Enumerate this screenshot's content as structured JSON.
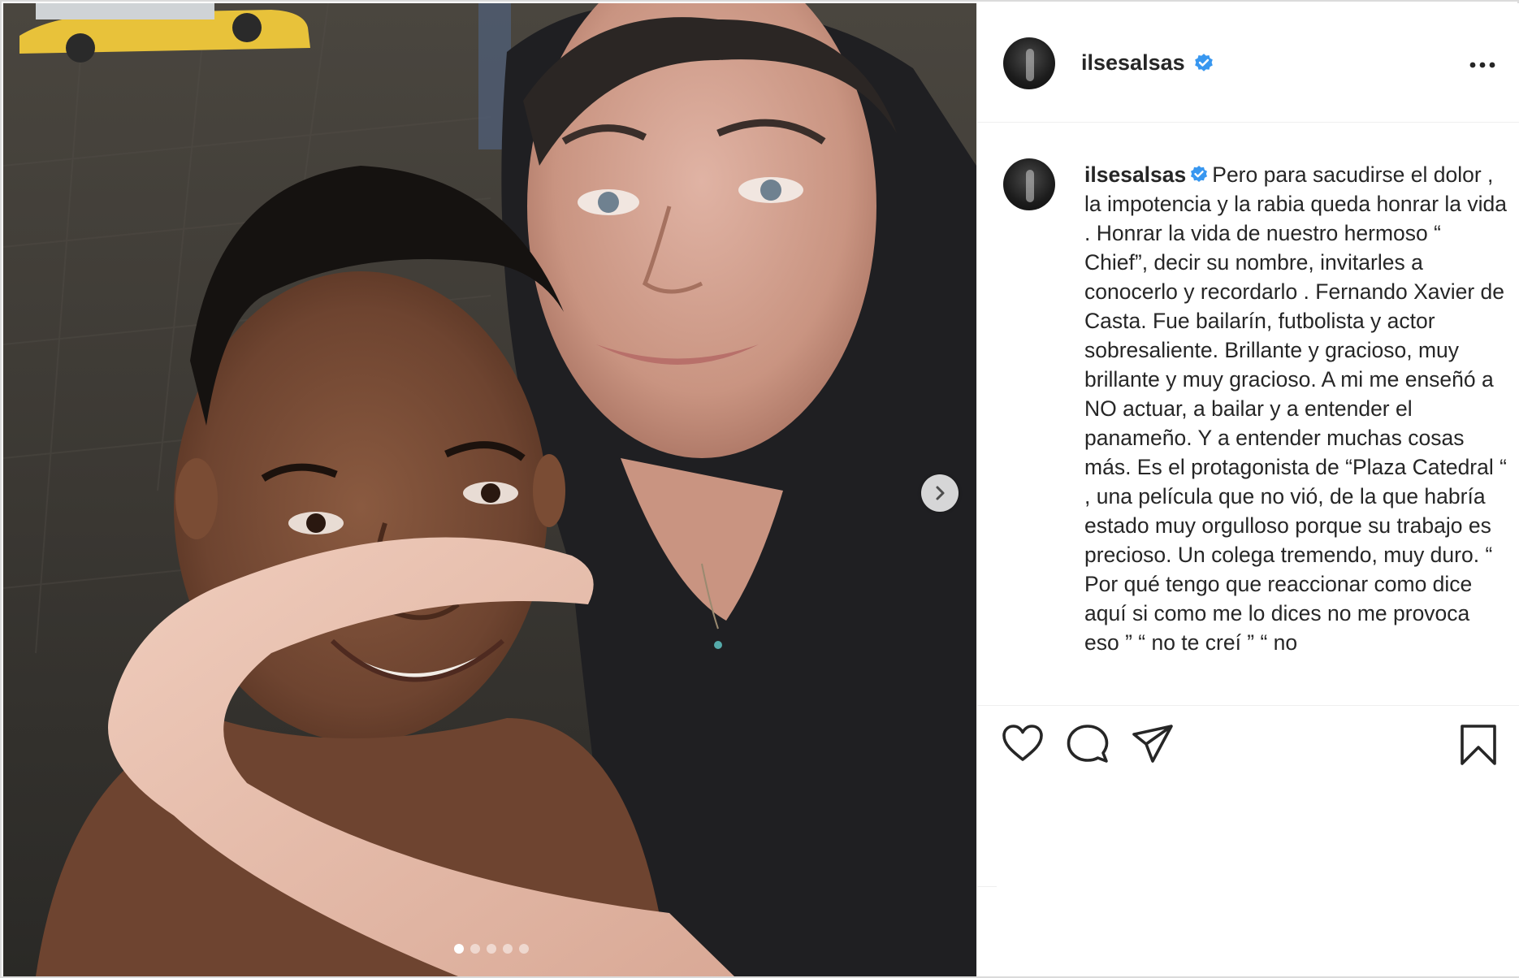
{
  "post": {
    "username": "ilsesalsas",
    "verified": true,
    "caption": "Pero para sacudirse el dolor , la impotencia y la rabia queda honrar la vida . Honrar la vida de nuestro hermoso “ Chief”, decir su nombre, invitarles a conocerlo y recordarlo . Fernando Xavier de Casta. Fue bailarín, futbolista y actor sobresaliente. Brillante y gracioso, muy brillante y muy gracioso. A mi me enseñó a NO actuar, a bailar y a entender el panameño. Y a entender muchas cosas más. Es el protagonista de “Plaza Catedral “ , una película que no vió, de la que habría estado muy orgulloso porque su trabajo es precioso. Un colega tremendo, muy duro. “ Por qué tengo que reaccionar como dice aquí si como me lo dices no me provoca eso ” “ no te creí ” “ no",
    "carousel": {
      "total": 5,
      "current": 1
    }
  },
  "icons": {
    "verified": "verified-badge-icon",
    "more": "more-options-icon",
    "next": "chevron-right-icon",
    "like": "heart-icon",
    "comment": "comment-icon",
    "share": "paper-plane-icon",
    "save": "bookmark-icon"
  },
  "colors": {
    "verified_blue": "#3897f0",
    "text": "#262626",
    "border": "#dbdbdb"
  }
}
